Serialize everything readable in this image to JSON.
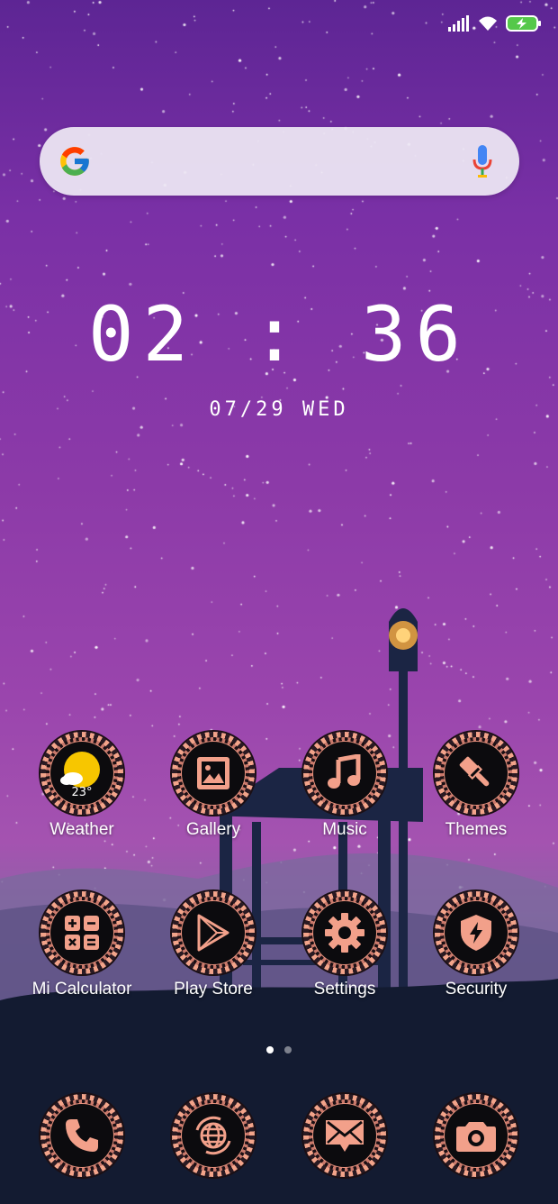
{
  "status_bar": {
    "icons": [
      "signal-icon",
      "wifi-icon",
      "battery-charging-icon"
    ]
  },
  "search": {
    "logo": "google-logo-icon",
    "mic": "mic-icon"
  },
  "clock": {
    "time": "02 : 36",
    "date": "07/29 WED"
  },
  "apps_row1": [
    {
      "label": "Weather",
      "icon": "weather-icon",
      "temp": "23°"
    },
    {
      "label": "Gallery",
      "icon": "gallery-icon"
    },
    {
      "label": "Music",
      "icon": "music-icon"
    },
    {
      "label": "Themes",
      "icon": "themes-icon"
    }
  ],
  "apps_row2": [
    {
      "label": "Mi Calculator",
      "icon": "calculator-icon"
    },
    {
      "label": "Play Store",
      "icon": "play-store-icon"
    },
    {
      "label": "Settings",
      "icon": "settings-icon"
    },
    {
      "label": "Security",
      "icon": "security-icon"
    }
  ],
  "page_indicator": {
    "pages": 2,
    "current": 1
  },
  "dock": [
    {
      "icon": "phone-icon"
    },
    {
      "icon": "browser-icon"
    },
    {
      "icon": "messages-icon"
    },
    {
      "icon": "camera-icon"
    }
  ],
  "colors": {
    "accent": "#F2A08A",
    "icon_bg": "#0C0B0E",
    "sky_top": "#5D2594",
    "sky_mid": "#9A45AD",
    "ground": "#141C33"
  }
}
